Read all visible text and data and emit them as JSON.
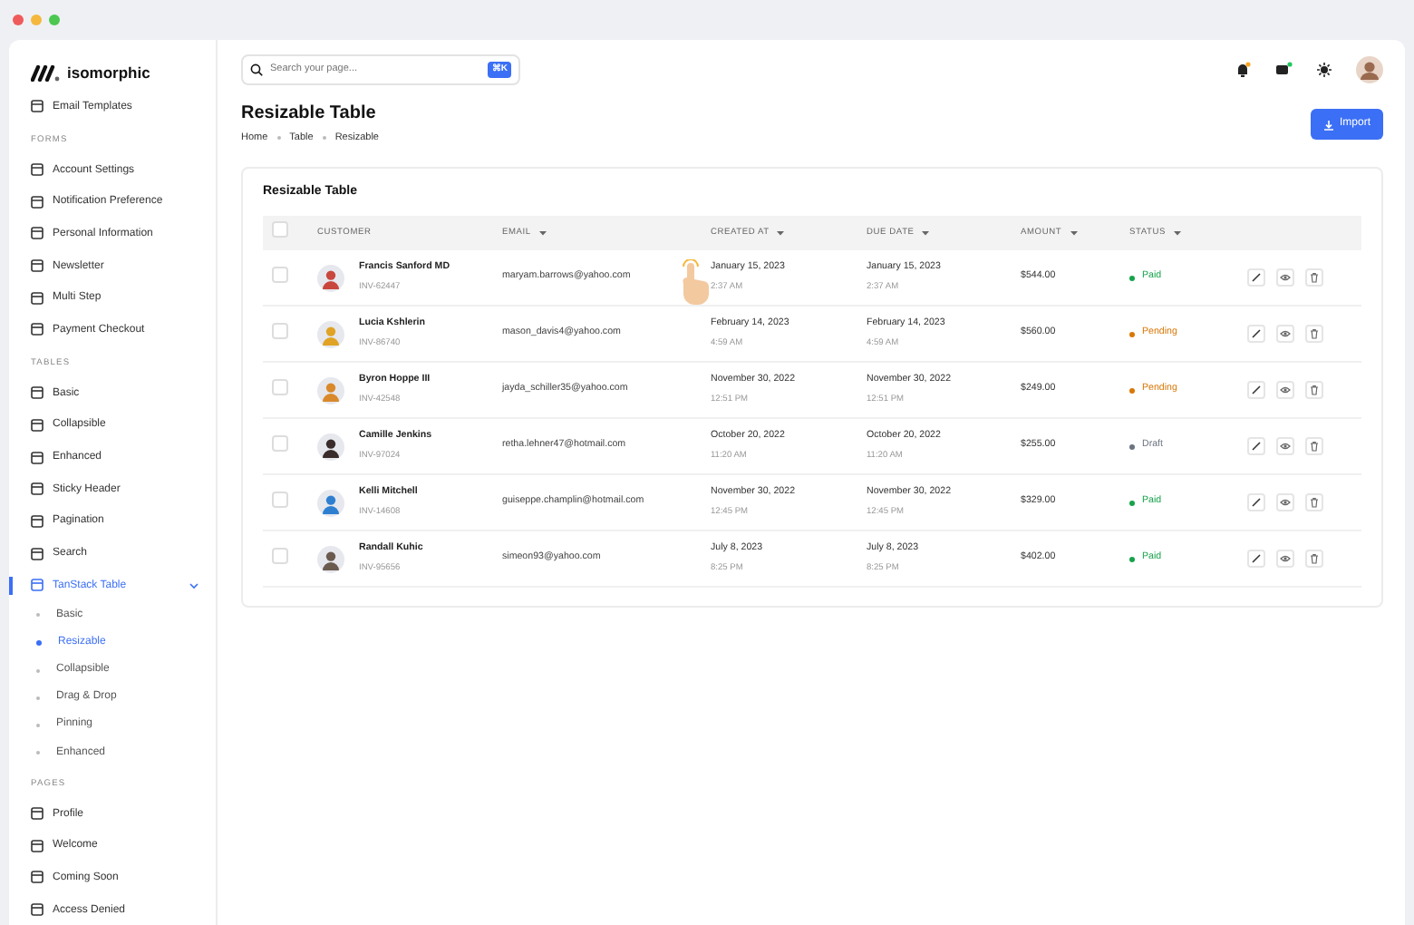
{
  "sidebar": {
    "logo": "isomorphic",
    "groups": [
      {
        "items": [
          {
            "label": "Email Templates",
            "selected": false
          }
        ]
      },
      {
        "heading": "FORMS",
        "items": [
          {
            "label": "Account Settings",
            "selected": false
          },
          {
            "label": "Notification Preference",
            "selected": false
          },
          {
            "label": "Personal Information",
            "selected": false
          },
          {
            "label": "Newsletter",
            "selected": false
          },
          {
            "label": "Multi Step",
            "selected": false
          },
          {
            "label": "Payment Checkout",
            "selected": false
          }
        ]
      },
      {
        "heading": "TABLES",
        "items": [
          {
            "label": "Basic",
            "selected": false
          },
          {
            "label": "Collapsible",
            "selected": false
          },
          {
            "label": "Enhanced",
            "selected": false
          },
          {
            "label": "Sticky Header",
            "selected": false
          },
          {
            "label": "Pagination",
            "selected": false
          },
          {
            "label": "Search",
            "selected": false
          },
          {
            "label": "TanStack Table",
            "selected": true,
            "expanded": true,
            "children": [
              {
                "label": "Basic",
                "selected": false
              },
              {
                "label": "Resizable",
                "selected": true
              },
              {
                "label": "Collapsible",
                "selected": false
              },
              {
                "label": "Drag & Drop",
                "selected": false
              },
              {
                "label": "Pinning",
                "selected": false
              },
              {
                "label": "Enhanced",
                "selected": false
              }
            ]
          }
        ]
      },
      {
        "heading": "PAGES",
        "items": [
          {
            "label": "Profile",
            "selected": false
          },
          {
            "label": "Welcome",
            "selected": false
          },
          {
            "label": "Coming Soon",
            "selected": false
          },
          {
            "label": "Access Denied",
            "selected": false
          }
        ]
      }
    ]
  },
  "search": {
    "placeholder": "Search your page...",
    "shortcut": "⌘K"
  },
  "page": {
    "title": "Resizable Table",
    "breadcrumb": [
      "Home",
      "Table",
      "Resizable"
    ],
    "import_button": "Import"
  },
  "table": {
    "title": "Resizable Table",
    "select_all_checked": false,
    "columns": [
      {
        "label": "CUSTOMER",
        "sortable": false
      },
      {
        "label": "EMAIL",
        "sortable": true
      },
      {
        "label": "CREATED AT",
        "sortable": true
      },
      {
        "label": "DUE DATE",
        "sortable": true
      },
      {
        "label": "AMOUNT",
        "sortable": true
      },
      {
        "label": "STATUS",
        "sortable": true
      }
    ],
    "rows": [
      {
        "checked": false,
        "name": "Francis Sanford MD",
        "invoice": "INV-62447",
        "email": "maryam.barrows@yahoo.com",
        "created_date": "January 15, 2023",
        "created_time": "2:37 AM",
        "due_date": "January 15, 2023",
        "due_time": "2:37 AM",
        "amount": "$544.00",
        "status": {
          "label": "Paid",
          "color": "#16a34a"
        }
      },
      {
        "checked": false,
        "name": "Lucia Kshlerin",
        "invoice": "INV-86740",
        "email": "mason_davis4@yahoo.com",
        "created_date": "February 14, 2023",
        "created_time": "4:59 AM",
        "due_date": "February 14, 2023",
        "due_time": "4:59 AM",
        "amount": "$560.00",
        "status": {
          "label": "Pending",
          "color": "#d97706"
        }
      },
      {
        "checked": false,
        "name": "Byron Hoppe III",
        "invoice": "INV-42548",
        "email": "jayda_schiller35@yahoo.com",
        "created_date": "November 30, 2022",
        "created_time": "12:51 PM",
        "due_date": "November 30, 2022",
        "due_time": "12:51 PM",
        "amount": "$249.00",
        "status": {
          "label": "Pending",
          "color": "#d97706"
        }
      },
      {
        "checked": false,
        "name": "Camille Jenkins",
        "invoice": "INV-97024",
        "email": "retha.lehner47@hotmail.com",
        "created_date": "October 20, 2022",
        "created_time": "11:20 AM",
        "due_date": "October 20, 2022",
        "due_time": "11:20 AM",
        "amount": "$255.00",
        "status": {
          "label": "Draft",
          "color": "#6b7280"
        }
      },
      {
        "checked": false,
        "name": "Kelli Mitchell",
        "invoice": "INV-14608",
        "email": "guiseppe.champlin@hotmail.com",
        "created_date": "November 30, 2022",
        "created_time": "12:45 PM",
        "due_date": "November 30, 2022",
        "due_time": "12:45 PM",
        "amount": "$329.00",
        "status": {
          "label": "Paid",
          "color": "#16a34a"
        }
      },
      {
        "checked": false,
        "name": "Randall Kuhic",
        "invoice": "INV-95656",
        "email": "simeon93@yahoo.com",
        "created_date": "July 8, 2023",
        "created_time": "8:25 PM",
        "due_date": "July 8, 2023",
        "due_time": "8:25 PM",
        "amount": "$402.00",
        "status": {
          "label": "Paid",
          "color": "#16a34a"
        }
      }
    ]
  }
}
